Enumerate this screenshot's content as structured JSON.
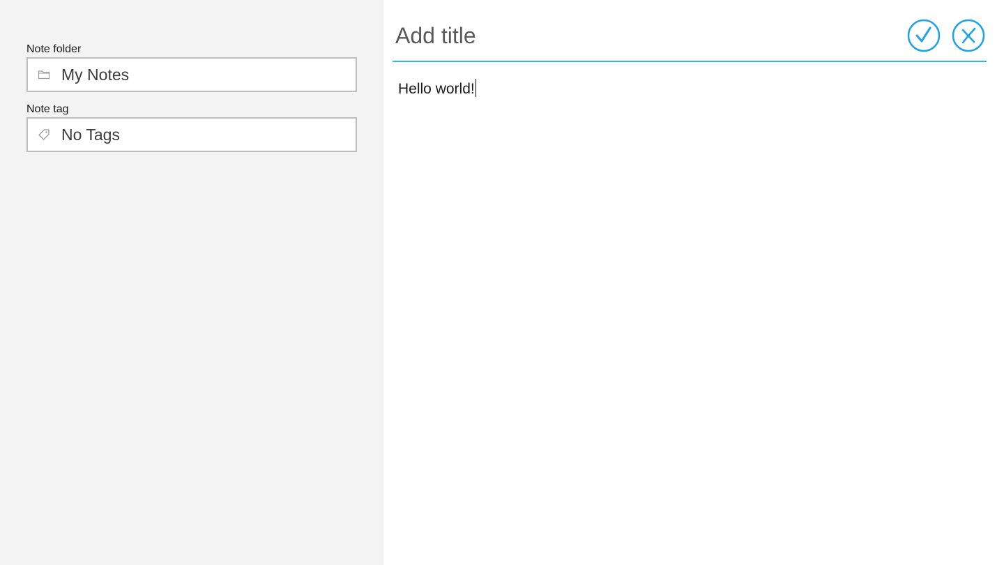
{
  "left_panel": {
    "folder": {
      "label": "Note folder",
      "value": "My Notes",
      "icon": "folder-icon"
    },
    "tag": {
      "label": "Note tag",
      "value": "No Tags",
      "icon": "tag-icon"
    }
  },
  "editor": {
    "title_placeholder": "Add title",
    "title_value": "",
    "body_text": "Hello world!",
    "confirm_icon": "checkmark-circle-icon",
    "cancel_icon": "close-circle-icon"
  },
  "colors": {
    "accent": "#1ea3e6",
    "title_underline": "#35b3ea",
    "left_panel_bg": "#f3f3f3",
    "field_border": "#bdbdbd"
  }
}
